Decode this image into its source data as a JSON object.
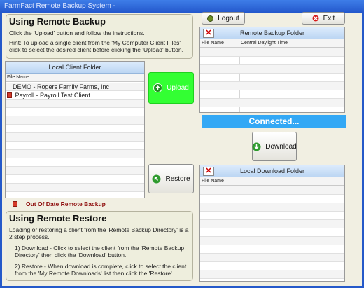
{
  "window": {
    "title": "FarmFact Remote Backup System -"
  },
  "backup_help": {
    "title": "Using Remote Backup",
    "line1": "Click the 'Upload' button and follow the instructions.",
    "hint": "Hint:  To upload a single client from the 'My Computer Client Files' click to select the desired client before clicking the 'Upload' button."
  },
  "local_folder": {
    "title": "Local Client Folder",
    "column_file_name": "File Name",
    "rows": [
      {
        "label": "DEMO - Rogers Family Farms, Inc",
        "flagged": false
      },
      {
        "label": "Payroll - Payroll Test Client",
        "flagged": true
      }
    ]
  },
  "buttons": {
    "logout": "Logout",
    "exit": "Exit",
    "upload": "Upload",
    "restore": "Restore",
    "download": "Download"
  },
  "remote_folder": {
    "title": "Remote Backup Folder",
    "column_file_name": "File Name",
    "column_time": "Central Daylight Time"
  },
  "status": {
    "text": "Connected..."
  },
  "download_folder": {
    "title": "Local Download Folder",
    "column_file_name": "File Name"
  },
  "legend": {
    "out_of_date": "Out Of Date Remote Backup"
  },
  "restore_help": {
    "title": "Using Remote Restore",
    "intro": "Loading or restoring a client from the 'Remote Backup Directory' is a 2 step process.",
    "step1": "1) Download - Click to select the client from the 'Remote Backup Directory'        then click the 'Download' button.",
    "step2": "2) Restore - When download is complete, click to select the client from the            'My Remote Downloads' list then click the 'Restore'"
  },
  "colors": {
    "title_bar": "#2458cc",
    "upload_green": "#33ff33",
    "status_blue": "#33a8f5",
    "grid_header": "#bcd6f3",
    "out_of_date_red": "#8e0d0d"
  }
}
